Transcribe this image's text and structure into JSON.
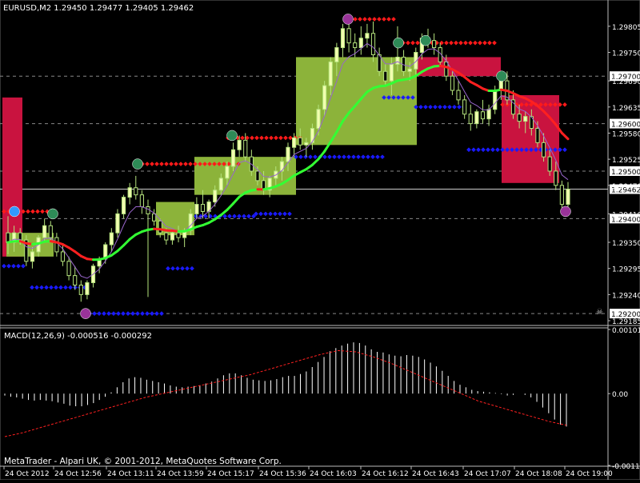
{
  "header": {
    "symbol_line": "EURUSD,M2  1.29450 1.29477 1.29405 1.29462"
  },
  "macd_label": "MACD(12,26,9) -0.000516 -0.000292",
  "footer": "MetaTrader - Alpari UK, © 2001-2012, MetaQuotes Software Corp.",
  "colors": {
    "background": "#000000",
    "grid": "#9a9a9a",
    "bull_candle": "#f2ffb0",
    "bear_candle": "#000000",
    "candle_outline": "#b5e37d",
    "box_green": "#8cb33a",
    "box_red": "#c9133f",
    "resistance_dots": "#ff1a1a",
    "support_dots": "#1a1aff",
    "ma_green": "#33ff33",
    "ma_red": "#ff2020",
    "ma_yellow": "#ffff00",
    "ma_purple": "#9966cc",
    "macd_hist": "#ffffff",
    "macd_signal": "#ff2020"
  },
  "chart_data": [
    {
      "type": "candlestick",
      "title": "EURUSD,M2",
      "y_ticks": [
        "1.29805",
        "1.29750",
        "1.29690",
        "1.29635",
        "1.29580",
        "1.29525",
        "1.29470",
        "1.29410",
        "1.29350",
        "1.29295",
        "1.29240",
        "1.29185"
      ],
      "price_tags": [
        "1.29700",
        "1.29600",
        "1.29500",
        "1.29462",
        "1.29400",
        "1.29200"
      ],
      "current_price": 1.29462,
      "x_labels": [
        "24 Oct 2012",
        "24 Oct 12:56",
        "24 Oct 13:11",
        "24 Oct 13:59",
        "24 Oct 15:17",
        "24 Oct 15:36",
        "24 Oct 16:03",
        "24 Oct 16:12",
        "24 Oct 16:43",
        "24 Oct 17:07",
        "24 Oct 18:08",
        "24 Oct 19:00"
      ],
      "ylim": [
        1.2918,
        1.2983
      ],
      "candles": [
        [
          1.2937,
          1.29405,
          1.29325,
          1.2935
        ],
        [
          1.2935,
          1.29385,
          1.2933,
          1.2937
        ],
        [
          1.2937,
          1.2938,
          1.29345,
          1.29355
        ],
        [
          1.29355,
          1.29365,
          1.293,
          1.2931
        ],
        [
          1.2931,
          1.2934,
          1.29295,
          1.2933
        ],
        [
          1.2933,
          1.29365,
          1.2932,
          1.2936
        ],
        [
          1.2936,
          1.294,
          1.2935,
          1.29385
        ],
        [
          1.29385,
          1.29395,
          1.29355,
          1.2936
        ],
        [
          1.2936,
          1.2937,
          1.2932,
          1.2933
        ],
        [
          1.2933,
          1.29345,
          1.293,
          1.2931
        ],
        [
          1.2931,
          1.2932,
          1.2927,
          1.2928
        ],
        [
          1.2928,
          1.293,
          1.2925,
          1.2926
        ],
        [
          1.2926,
          1.2927,
          1.29225,
          1.2924
        ],
        [
          1.2924,
          1.2927,
          1.2923,
          1.29265
        ],
        [
          1.29265,
          1.29305,
          1.29255,
          1.293
        ],
        [
          1.293,
          1.2932,
          1.29285,
          1.29315
        ],
        [
          1.29315,
          1.2935,
          1.29305,
          1.29345
        ],
        [
          1.29345,
          1.2938,
          1.2933,
          1.2937
        ],
        [
          1.2937,
          1.2942,
          1.2936,
          1.2941
        ],
        [
          1.2941,
          1.2945,
          1.294,
          1.29445
        ],
        [
          1.29445,
          1.29475,
          1.2943,
          1.29465
        ],
        [
          1.29465,
          1.2949,
          1.2944,
          1.2945
        ],
        [
          1.2945,
          1.2946,
          1.2941,
          1.29425
        ],
        [
          1.29425,
          1.2944,
          1.29235,
          1.2941
        ],
        [
          1.2941,
          1.2942,
          1.29385,
          1.29395
        ],
        [
          1.29395,
          1.294,
          1.2936,
          1.2937
        ],
        [
          1.2937,
          1.2938,
          1.29345,
          1.29355
        ],
        [
          1.29355,
          1.29375,
          1.29345,
          1.2937
        ],
        [
          1.2937,
          1.29385,
          1.2935,
          1.2936
        ],
        [
          1.2936,
          1.2938,
          1.2934,
          1.29375
        ],
        [
          1.29375,
          1.2942,
          1.29365,
          1.2941
        ],
        [
          1.2941,
          1.29445,
          1.294,
          1.2943
        ],
        [
          1.2943,
          1.2946,
          1.294,
          1.29415
        ],
        [
          1.29415,
          1.2944,
          1.294,
          1.29435
        ],
        [
          1.29435,
          1.2947,
          1.29425,
          1.2946
        ],
        [
          1.2946,
          1.29495,
          1.2945,
          1.29485
        ],
        [
          1.29485,
          1.2952,
          1.2947,
          1.2951
        ],
        [
          1.2951,
          1.2956,
          1.295,
          1.29545
        ],
        [
          1.29545,
          1.29575,
          1.2953,
          1.29565
        ],
        [
          1.29565,
          1.2958,
          1.2952,
          1.2953
        ],
        [
          1.2953,
          1.29545,
          1.2949,
          1.295
        ],
        [
          1.295,
          1.2951,
          1.2947,
          1.2948
        ],
        [
          1.2948,
          1.295,
          1.2945,
          1.2946
        ],
        [
          1.2946,
          1.2949,
          1.29445,
          1.29485
        ],
        [
          1.29485,
          1.2951,
          1.2947,
          1.295
        ],
        [
          1.295,
          1.2953,
          1.2948,
          1.2952
        ],
        [
          1.2952,
          1.2956,
          1.295,
          1.2955
        ],
        [
          1.2955,
          1.2958,
          1.2953,
          1.2957
        ],
        [
          1.2957,
          1.2959,
          1.29545,
          1.29555
        ],
        [
          1.29555,
          1.2957,
          1.2953,
          1.2956
        ],
        [
          1.2956,
          1.296,
          1.29545,
          1.2959
        ],
        [
          1.2959,
          1.2964,
          1.29575,
          1.2963
        ],
        [
          1.2963,
          1.2969,
          1.29615,
          1.2968
        ],
        [
          1.2968,
          1.2974,
          1.2966,
          1.2973
        ],
        [
          1.2973,
          1.2977,
          1.297,
          1.2976
        ],
        [
          1.2976,
          1.2981,
          1.2974,
          1.298
        ],
        [
          1.298,
          1.29815,
          1.2975,
          1.2977
        ],
        [
          1.2977,
          1.2979,
          1.2974,
          1.2976
        ],
        [
          1.2976,
          1.29805,
          1.29745,
          1.2978
        ],
        [
          1.2978,
          1.2981,
          1.2976,
          1.2979
        ],
        [
          1.2979,
          1.29815,
          1.2973,
          1.29745
        ],
        [
          1.29745,
          1.2976,
          1.297,
          1.2971
        ],
        [
          1.2971,
          1.29725,
          1.2968,
          1.2969
        ],
        [
          1.2969,
          1.2974,
          1.2966,
          1.29725
        ],
        [
          1.29725,
          1.29805,
          1.2971,
          1.2974
        ],
        [
          1.2974,
          1.29755,
          1.297,
          1.2971
        ],
        [
          1.2971,
          1.2973,
          1.2969,
          1.29715
        ],
        [
          1.29715,
          1.2976,
          1.297,
          1.2975
        ],
        [
          1.2975,
          1.2979,
          1.29735,
          1.2978
        ],
        [
          1.2978,
          1.298,
          1.2976,
          1.29775
        ],
        [
          1.29775,
          1.2979,
          1.29745,
          1.2976
        ],
        [
          1.2976,
          1.2977,
          1.2972,
          1.2973
        ],
        [
          1.2973,
          1.29745,
          1.2969,
          1.297
        ],
        [
          1.297,
          1.2971,
          1.2966,
          1.2967
        ],
        [
          1.2967,
          1.2969,
          1.2964,
          1.2965
        ],
        [
          1.2965,
          1.2966,
          1.2961,
          1.2962
        ],
        [
          1.2962,
          1.2964,
          1.29585,
          1.296
        ],
        [
          1.296,
          1.2963,
          1.2959,
          1.29625
        ],
        [
          1.29625,
          1.2965,
          1.296,
          1.2961
        ],
        [
          1.2961,
          1.2964,
          1.29595,
          1.2963
        ],
        [
          1.2963,
          1.2968,
          1.2962,
          1.2967
        ],
        [
          1.2967,
          1.297,
          1.2965,
          1.2969
        ],
        [
          1.2969,
          1.2971,
          1.2964,
          1.2965
        ],
        [
          1.2965,
          1.2967,
          1.2961,
          1.2962
        ],
        [
          1.2962,
          1.2964,
          1.2959,
          1.29605
        ],
        [
          1.29605,
          1.29625,
          1.2958,
          1.29615
        ],
        [
          1.29615,
          1.2963,
          1.29575,
          1.2959
        ],
        [
          1.2959,
          1.29605,
          1.2955,
          1.2956
        ],
        [
          1.2956,
          1.2958,
          1.2952,
          1.2953
        ],
        [
          1.2953,
          1.29545,
          1.2949,
          1.295
        ],
        [
          1.295,
          1.2952,
          1.2946,
          1.2947
        ],
        [
          1.2947,
          1.2948,
          1.2941,
          1.2943
        ],
        [
          1.2943,
          1.29477,
          1.29405,
          1.29462
        ]
      ]
    },
    {
      "type": "bar",
      "title": "MACD(12,26,9)",
      "y_ticks": [
        "0.001014",
        "0.00",
        "-0.001135"
      ],
      "ylim": [
        -0.001135,
        0.001014
      ],
      "histogram": [
        -3e-05,
        -5e-05,
        -6e-05,
        -8e-05,
        -0.0001,
        -0.00011,
        -0.0001,
        -0.00011,
        -0.00012,
        -0.00014,
        -0.00016,
        -0.00019,
        -0.0002,
        -0.0002,
        -0.00018,
        -0.00015,
        -0.0001,
        -5e-05,
        2e-05,
        0.0001,
        0.00018,
        0.00024,
        0.00026,
        0.00025,
        0.00022,
        0.0002,
        0.00018,
        0.00016,
        0.00013,
        0.00011,
        0.0001,
        0.00011,
        0.00012,
        0.00013,
        0.00016,
        0.00019,
        0.00024,
        0.00029,
        0.00032,
        0.00032,
        0.00029,
        0.00025,
        0.00022,
        0.00021,
        0.0002,
        0.00021,
        0.00023,
        0.00026,
        0.00028,
        0.00028,
        0.00031,
        0.00035,
        0.00042,
        0.0005,
        0.00058,
        0.00067,
        0.00072,
        0.00076,
        0.00079,
        0.00081,
        0.0008,
        0.00076,
        0.0007,
        0.00066,
        0.00065,
        0.00062,
        0.0006,
        0.00059,
        0.00061,
        0.0006,
        0.00058,
        0.00054,
        0.00049,
        0.00043,
        0.00036,
        0.00028,
        0.0002,
        0.00014,
        0.0001,
        6e-05,
        4e-05,
        3e-05,
        2e-05,
        1e-05,
        -1e-05,
        -3e-05,
        -2e-05,
        0.0,
        -2e-05,
        -6e-05,
        -0.00013,
        -0.00022,
        -0.00031,
        -0.00041,
        -0.00049,
        -0.00052
      ],
      "signal": [
        -0.00068,
        -0.00062,
        -0.00054,
        -0.00046,
        -0.00038,
        -0.0003,
        -0.00022,
        -0.00014,
        -6e-05,
        0.0,
        6e-05,
        0.00012,
        0.00018,
        0.00024,
        0.0003,
        0.00038,
        0.00046,
        0.00054,
        0.00062,
        0.00068,
        0.00066,
        0.00058,
        0.00048,
        0.00036,
        0.00024,
        0.00012,
        0.0,
        -0.00012,
        -0.0002,
        -0.00028,
        -0.00036,
        -0.00044,
        -0.0005
      ]
    }
  ]
}
